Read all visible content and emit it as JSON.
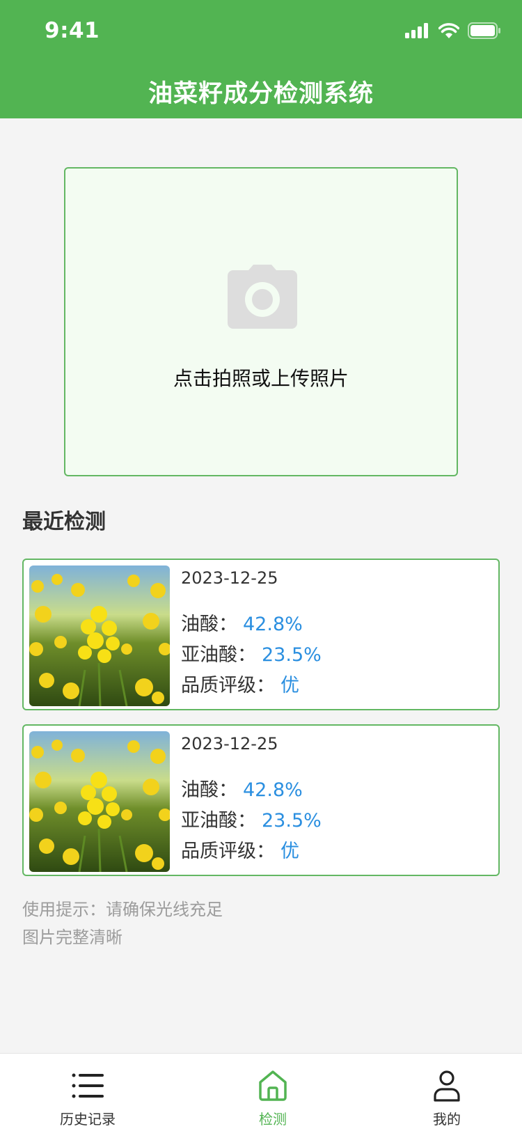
{
  "status_bar": {
    "time": "9:41"
  },
  "header": {
    "title": "油菜籽成分检测系统"
  },
  "upload": {
    "prompt": "点击拍照或上传照片",
    "icon": "camera-icon"
  },
  "recent": {
    "title": "最近检测",
    "records": [
      {
        "date": "2023-12-25",
        "oleic_label": "油酸：",
        "oleic_value": "42.8%",
        "linoleic_label": "亚油酸：",
        "linoleic_value": "23.5%",
        "grade_label": "品质评级：",
        "grade_value": "优"
      },
      {
        "date": "2023-12-25",
        "oleic_label": "油酸：",
        "oleic_value": "42.8%",
        "linoleic_label": "亚油酸：",
        "linoleic_value": "23.5%",
        "grade_label": "品质评级：",
        "grade_value": "优"
      }
    ]
  },
  "tips": {
    "line1": "使用提示：请确保光线充足",
    "line2": "图片完整清晰"
  },
  "tabbar": {
    "items": [
      {
        "label": "历史记录",
        "icon": "list-icon"
      },
      {
        "label": "检测",
        "icon": "home-icon"
      },
      {
        "label": "我的",
        "icon": "user-icon"
      }
    ],
    "active_color": "#52b452"
  },
  "colors": {
    "brand": "#52b452",
    "value": "#2b8fe0",
    "card_border": "#63b763"
  }
}
